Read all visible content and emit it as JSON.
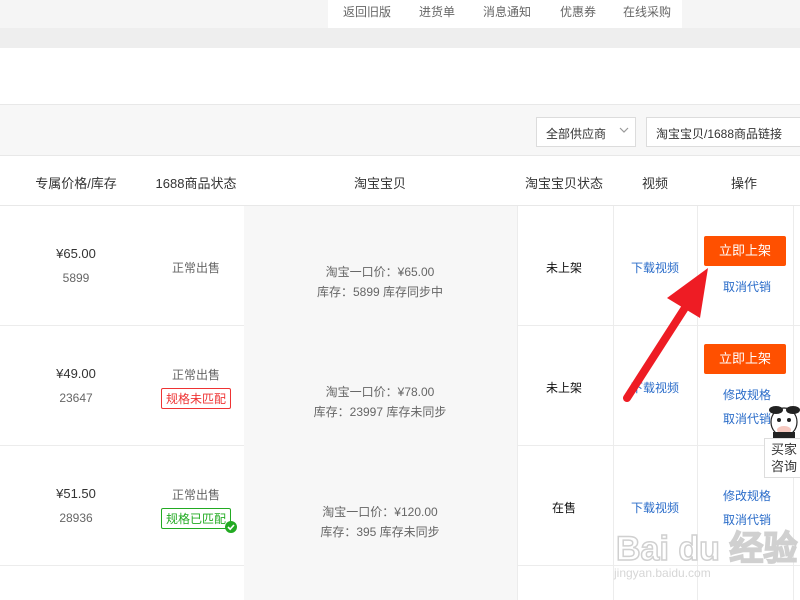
{
  "topnav": {
    "items": [
      "返回旧版",
      "进货单",
      "消息通知",
      "优惠券",
      "在线采购"
    ]
  },
  "filters": {
    "supplier_select": "全部供应商",
    "search_placeholder": "淘宝宝贝/1688商品链接"
  },
  "table": {
    "columns": [
      "专属价格/库存",
      "1688商品状态",
      "淘宝宝贝",
      "淘宝宝贝状态",
      "视频",
      "操作"
    ],
    "rows": [
      {
        "price": "¥65.00",
        "stock": "5899",
        "status_1688": "正常出售",
        "spec_badge": "",
        "taobao_price": "淘宝一口价：¥65.00",
        "taobao_stock": "库存：5899 库存同步中",
        "taobao_status": "未上架",
        "video": "下载视频",
        "actions": [
          "立即上架",
          "取消代销"
        ]
      },
      {
        "price": "¥49.00",
        "stock": "23647",
        "status_1688": "正常出售",
        "spec_badge": "规格未匹配",
        "taobao_price": "淘宝一口价：¥78.00",
        "taobao_stock": "库存：23997 库存未同步",
        "taobao_status": "未上架",
        "video": "下载视频",
        "actions": [
          "立即上架",
          "修改规格",
          "取消代销"
        ]
      },
      {
        "price": "¥51.50",
        "stock": "28936",
        "status_1688": "正常出售",
        "spec_badge": "规格已匹配",
        "taobao_price": "淘宝一口价：¥120.00",
        "taobao_stock": "库存：395 库存未同步",
        "taobao_status": "在售",
        "video": "下载视频",
        "actions": [
          "修改规格",
          "取消代销"
        ]
      }
    ]
  },
  "consult": {
    "line1": "买家",
    "line2": "咨询"
  },
  "watermark": {
    "logo": "Bai du 经验",
    "url": "jingyan.baidu.com"
  },
  "colors": {
    "primary_button": "#ff5000",
    "link": "#2a6cc9",
    "badge_unmatched": "#ee3333",
    "badge_matched": "#22aa22",
    "annotation_arrow": "#ee1c24"
  }
}
